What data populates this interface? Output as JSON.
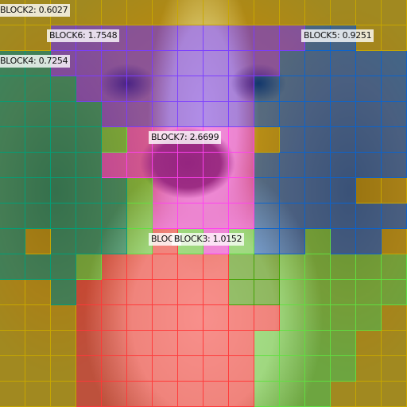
{
  "legend": {
    "Y": {
      "name": "BLOCK2",
      "color": "#c8a800"
    },
    "P": {
      "name": "BLOCK6",
      "color": "#7a3cff"
    },
    "B": {
      "name": "BLOCK5",
      "color": "#0a64d0"
    },
    "T": {
      "name": "BLOCK4",
      "color": "#00a078"
    },
    "M": {
      "name": "BLOCK7",
      "color": "#ff40f0"
    },
    "R": {
      "name": "BLOCK3",
      "color": "#ff3838"
    },
    "G": {
      "name": "",
      "color": "#60e040"
    },
    "D": {
      "name": "",
      "color": "#40a000"
    }
  },
  "grid": [
    "YYYYYYYYYYYYYYYY",
    "YYPPPPPPPPPPBBYY",
    "TTPPPPPPPPPBBBBB",
    "TTTPPPPPPPBBBBBB",
    "TTTTPPPPPPBBBBBB",
    "TTTTGMMMMMYBBBBB",
    "TTTTMMMMMMBBBBBB",
    "TTTTTGMMMMBBBBYY",
    "TTTTTGMMMMBBBBBB",
    "TYTTTGRGMGBBGBBY",
    "TTTGRRRRRDDGGGGG",
    "YYTRRRRRRDDGGGGG",
    "YYYRRRRRRRRGGGGY",
    "YYYRRRRRRRGGGGYY",
    "YYYRRRRRRRGGGGYY",
    "YYYRRRRRRRGGGYYY"
  ],
  "labels": {
    "block2": "BLOCK2: 0.6027",
    "block6": "BLOCK6: 1.7548",
    "block5": "BLOCK5: 0.9251",
    "block4": "BLOCK4: 0.7254",
    "block7": "BLOCK7: 2.6699",
    "block1_partial": "BLOCK",
    "block3": "BLOCK3: 1.0152"
  }
}
